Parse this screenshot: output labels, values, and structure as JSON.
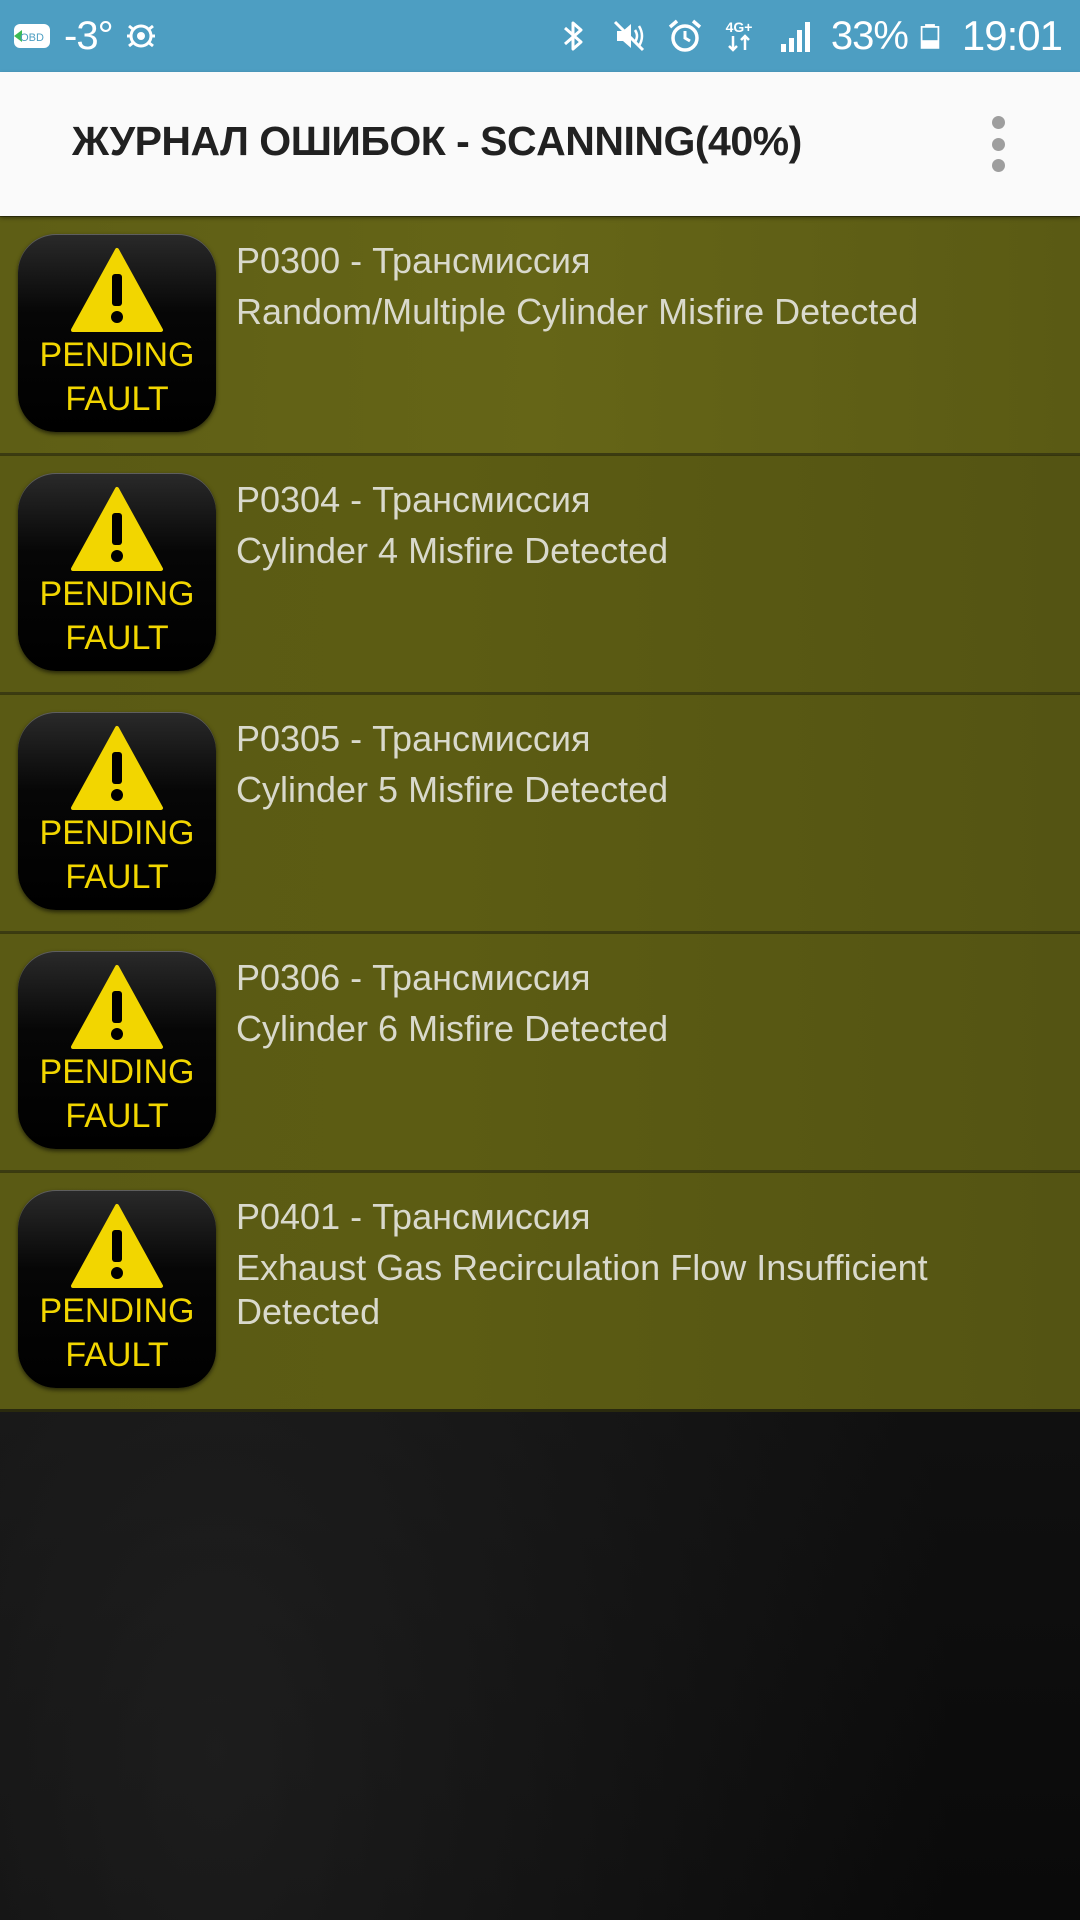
{
  "status_bar": {
    "app_icon": "obd-icon",
    "temperature": "-3°",
    "battery_percent": "33%",
    "time": "19:01",
    "network_label": "4G+",
    "icons": [
      "bluetooth-icon",
      "mute-icon",
      "alarm-icon",
      "signal-icon",
      "battery-icon",
      "android-debug-icon"
    ]
  },
  "app_bar": {
    "title": "ЖУРНАЛ ОШИБОК - SCANNING(40%)",
    "menu_icon": "overflow-menu-icon"
  },
  "badge": {
    "line1": "PENDING",
    "line2": "FAULT",
    "icon": "warning-icon",
    "text_color": "#f2d600"
  },
  "faults": [
    {
      "code": "P0300 - Трансмиссия",
      "description": "Random/Multiple Cylinder Misfire Detected"
    },
    {
      "code": "P0304 - Трансмиссия",
      "description": "Cylinder 4 Misfire Detected"
    },
    {
      "code": "P0305 - Трансмиссия",
      "description": "Cylinder 5 Misfire Detected"
    },
    {
      "code": "P0306 - Трансмиссия",
      "description": "Cylinder 6 Misfire Detected"
    },
    {
      "code": "P0401 - Трансмиссия",
      "description": "Exhaust Gas Recirculation Flow Insufficient Detected"
    }
  ],
  "colors": {
    "status_bar": "#4d9ec2",
    "app_bar": "#fafafa",
    "list_item": "#5c5c13",
    "text": "#d9d9cc"
  }
}
